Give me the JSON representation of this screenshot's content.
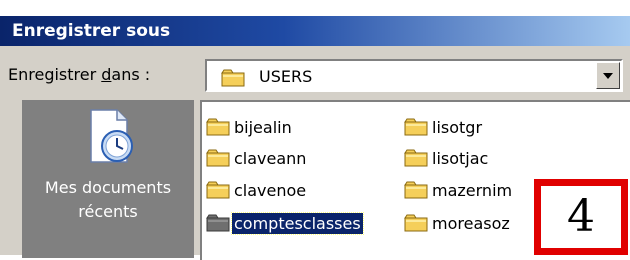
{
  "window": {
    "title": "Enregistrer sous"
  },
  "save_in": {
    "label": "Enregistrer dans :",
    "value": "USERS"
  },
  "places": [
    {
      "label_line1": "Mes documents",
      "label_line2": "récents",
      "icon": "recent-documents-icon"
    }
  ],
  "files": {
    "col1": [
      {
        "name": "bijealin",
        "icon": "folder-icon"
      },
      {
        "name": "claveann",
        "icon": "folder-icon"
      },
      {
        "name": "clavenoe",
        "icon": "folder-icon"
      },
      {
        "name": "comptesclasses",
        "icon": "folder-icon",
        "selected": true
      }
    ],
    "col2": [
      {
        "name": "lisotgr",
        "icon": "folder-icon"
      },
      {
        "name": "lisotjac",
        "icon": "folder-icon"
      },
      {
        "name": "mazernim",
        "icon": "folder-icon"
      },
      {
        "name": "moreasoz",
        "icon": "folder-icon"
      }
    ]
  },
  "annotation": {
    "number": "4",
    "border_color": "#e00000"
  },
  "colors": {
    "title_start": "#0a246a",
    "title_end": "#a6caf0",
    "selection": "#0a246a",
    "dialog_bg": "#d4d0c8",
    "places_bg": "#808080",
    "folder": "#f5cf5a"
  }
}
